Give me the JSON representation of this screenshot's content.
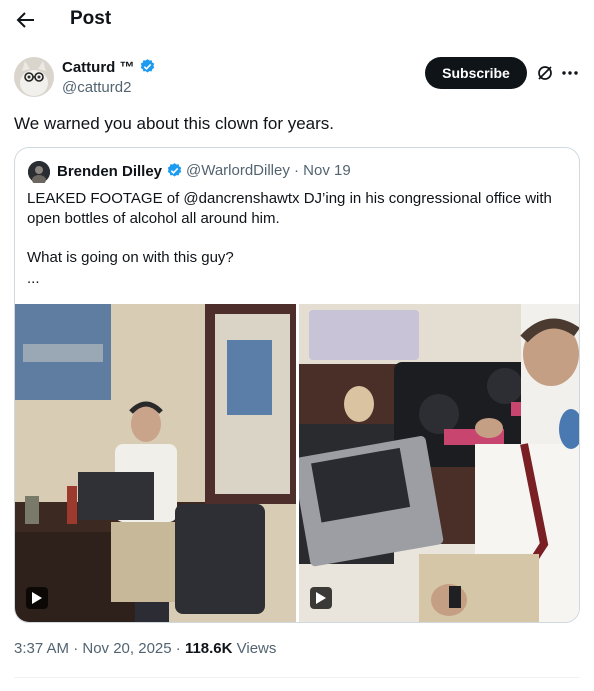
{
  "header": {
    "title": "Post",
    "back_icon": "arrow-left-icon"
  },
  "author": {
    "name": "Catturd ™",
    "handle": "@catturd2",
    "verified": true,
    "subscribe_label": "Subscribe"
  },
  "tweet": {
    "text": "We warned you about this clown for years."
  },
  "quote": {
    "name": "Brenden Dilley",
    "handle_date": "@WarlordDilley · Nov 19",
    "text": "LEAKED FOOTAGE of @dancrenshawtx DJ’ing in his congressional office with open bottles of alcohol all around him.",
    "text2": "What is going on with this guy?",
    "ellipsis": "..."
  },
  "meta": {
    "time": "3:37 AM · Nov 20, 2025 · ",
    "views_count": "118.6K",
    "views_label": " Views"
  },
  "colors": {
    "verified": "#1d9bf0",
    "secondary_text": "#536471",
    "border": "#cfd9de"
  }
}
